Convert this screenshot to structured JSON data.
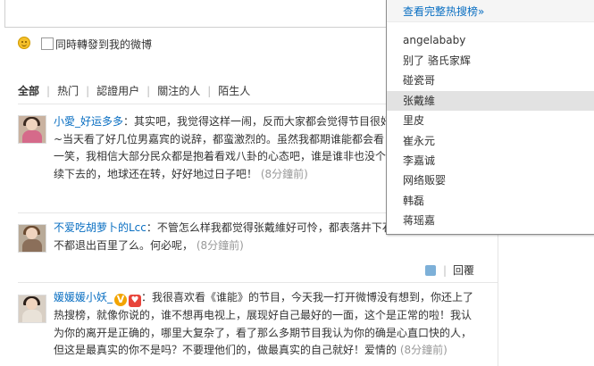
{
  "composer": {
    "repost_label": "同時轉發到我的微博"
  },
  "filter_tabs": [
    {
      "label": "全部",
      "active": true
    },
    {
      "label": "热门"
    },
    {
      "label": "認證用户"
    },
    {
      "label": "關注的人"
    },
    {
      "label": "陌生人"
    }
  ],
  "comments": [
    {
      "user": "小愛_好运多多",
      "lines": [
        "：其实吧，我觉得这样一闹，反而大家都会觉得节目很好看",
        "~当天看了好几位男嘉宾的说辞，都蛮激烈的。虽然我都期谁能都会看",
        "一笑，我相信大部分民众都是抱着看戏八卦的心态吧，谁是谁非也没个",
        "续下去的，地球还在转，好好地过日子吧！"
      ],
      "time": "(8分鐘前)"
    },
    {
      "user": "不爱吃胡萝卜的Lcc",
      "lines": [
        "：不管怎么样我都觉得张戴維好可怜，都表落井下石",
        "不都退出百里了么。何必呢，"
      ],
      "time": "(8分鐘前)"
    },
    {
      "user": "媛媛媛小妖_",
      "lines": [
        "：我很喜欢看《谁能》的节目，今天我一打开微博没有想到，你还上了",
        "热搜榜，就像你说的，谁不想再电视上，展现好自己最好的一面，这个是正常的啦！我认",
        "为你的离开是正确的，哪里大复杂了，看了那么多期节目我认为你的确是心直口快的人，",
        "但这是最真实的你不是吗？不要理他们的，做最真实的自己就好！爱情的"
      ],
      "time": "(8分鐘前)",
      "badge_v": "V",
      "badge_heart": "♥"
    }
  ],
  "reply_label": "回覆",
  "hot_search": {
    "header": "查看完整热搜榜»",
    "items": [
      "angelababy",
      "别了 骆氏家辉",
      "碰瓷哥",
      "张戴維",
      "里皮",
      "崔永元",
      "李嘉诚",
      "网络贩婴",
      "韩磊",
      "蒋瑶嘉"
    ],
    "highlighted_index": 3
  },
  "colors": {
    "link": "#0a6fc2",
    "timestamp": "#999999",
    "highlight": "#e2e2e2"
  }
}
